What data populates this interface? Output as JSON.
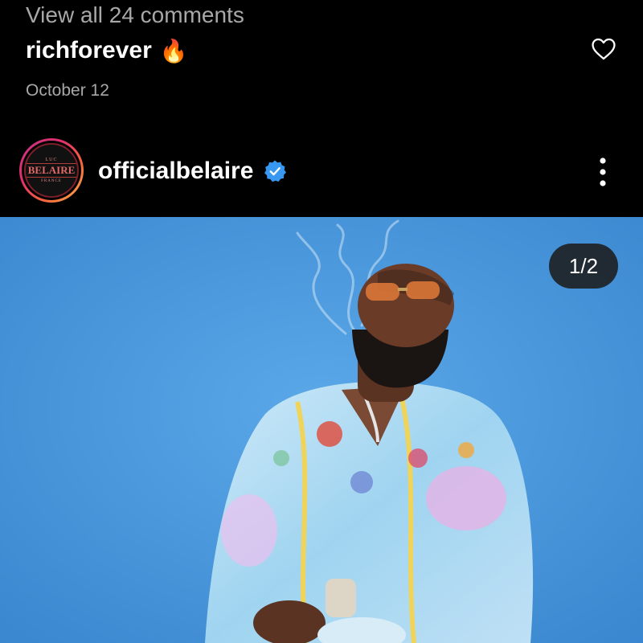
{
  "comments": {
    "view_all_label": "View all 24 comments",
    "top_comment_user": "richforever",
    "top_comment_emoji": "🔥",
    "date": "October 12"
  },
  "post": {
    "username": "officialbelaire",
    "verified": true,
    "avatar": {
      "top_text": "LUC",
      "brand_text": "BELAIRE",
      "bottom_text": "FRANCE"
    },
    "image_counter": "1/2",
    "image_description": "man in sunglasses and patterned pastel shirt exhaling smoke against blue background"
  },
  "colors": {
    "background": "#000000",
    "secondary_text": "#a8a8a8",
    "verified_badge": "#3897f0",
    "photo_backdrop": "#4a98dc",
    "avatar_ring_start": "#c13584",
    "avatar_ring_end": "#fcaf45"
  },
  "icons": {
    "like": "heart-outline-icon",
    "verified": "verified-badge-icon",
    "more": "more-vertical-icon"
  }
}
